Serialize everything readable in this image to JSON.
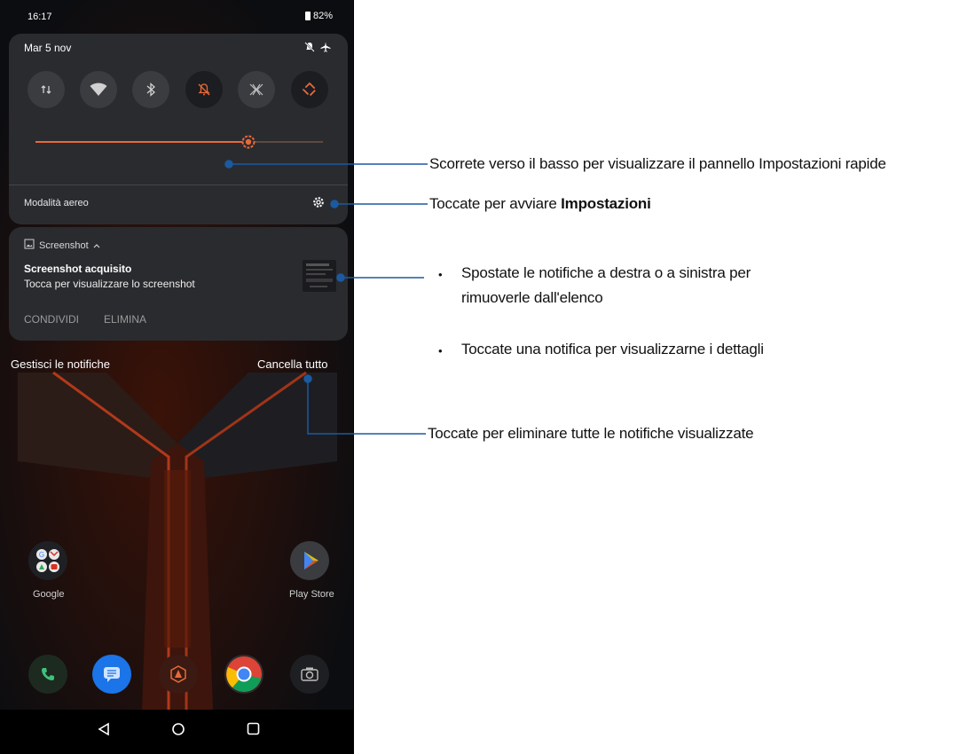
{
  "status_bar": {
    "time": "16:17",
    "battery": "82%"
  },
  "quick_settings": {
    "date": "Mar 5 nov",
    "tiles": [
      {
        "icon": "mobile-data-icon",
        "active": false
      },
      {
        "icon": "wifi-icon",
        "active": false
      },
      {
        "icon": "bluetooth-icon",
        "active": false
      },
      {
        "icon": "do-not-disturb-icon",
        "active": true
      },
      {
        "icon": "x-mode-icon",
        "active": false
      },
      {
        "icon": "auto-rotate-icon",
        "active": true
      }
    ],
    "brightness": 0.74,
    "footer_label": "Modalità aereo"
  },
  "notification": {
    "app_name": "Screenshot",
    "title": "Screenshot acquisito",
    "text": "Tocca per visualizzare lo screenshot",
    "actions": [
      "CONDIVIDI",
      "ELIMINA"
    ]
  },
  "shade_footer": {
    "manage": "Gestisci le notifiche",
    "clear_all": "Cancella tutto"
  },
  "home_apps": [
    {
      "label": "Google",
      "icon": "google-folder-icon"
    },
    {
      "label": "Play Store",
      "icon": "play-store-icon"
    }
  ],
  "dock": [
    "phone-icon",
    "messages-icon",
    "armoury-crate-icon",
    "chrome-icon",
    "camera-icon"
  ],
  "annotations": {
    "swipe": "Scorrete verso il basso per visualizzare il pannello Impostazioni rapide",
    "settings_prefix": "Toccate per avviare",
    "settings_bold": "Impostazioni",
    "bullet1_line1": "Spostate le notifiche a destra o a sinistra per",
    "bullet1_line2": "rimuoverle dall'elenco",
    "bullet2": "Toccate una notifica per visualizzarne i dettagli",
    "clear": "Toccate per eliminare tutte le notifiche visualizzate"
  },
  "colors": {
    "accent": "#e8693a",
    "callout": "#1a5aa0",
    "panel": "#2a2b2f"
  }
}
